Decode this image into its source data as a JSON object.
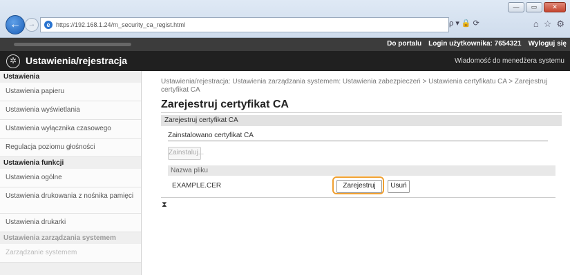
{
  "browser": {
    "url": "https://192.168.1.24/rn_security_ca_regist.html",
    "search_placeholder": "ρ ▾ 🔒 ⟳",
    "window_controls": [
      "—",
      "▭",
      "✕"
    ]
  },
  "header": {
    "portal_link": "Do portalu",
    "login_label": "Login użytkownika:",
    "login_value": "7654321",
    "logout_link": "Wyloguj się",
    "app_title": "Ustawienia/rejestracja",
    "message_link": "Wiadomość do menedżera systemu"
  },
  "sidebar": {
    "section1": "Ustawienia",
    "items1": [
      "Ustawienia papieru",
      "Ustawienia wyświetlania",
      "Ustawienia wyłącznika czasowego",
      "Regulacja poziomu głośności"
    ],
    "section2": "Ustawienia funkcji",
    "items2": [
      "Ustawienia ogólne",
      "Ustawienia drukowania z nośnika pamięci",
      "Ustawienia drukarki"
    ],
    "section3": "Ustawienia zarządzania systemem",
    "section3_sub": "Zarządzanie systemem"
  },
  "main": {
    "breadcrumb": "Ustawienia/rejestracja: Ustawienia zarządzania systemem: Ustawienia zabezpieczeń > Ustawienia certyfikatu CA > Zarejestruj certyfikat CA",
    "title": "Zarejestruj certyfikat CA",
    "section_header": "Zarejestruj certyfikat CA",
    "installed_header": "Zainstalowano certyfikat CA",
    "install_button": "Zainstaluj...",
    "file_col_header": "Nazwa pliku",
    "file_name": "EXAMPLE.CER",
    "register_button": "Zarejestruj",
    "delete_button": "Usuń",
    "top_link": "⧗"
  }
}
